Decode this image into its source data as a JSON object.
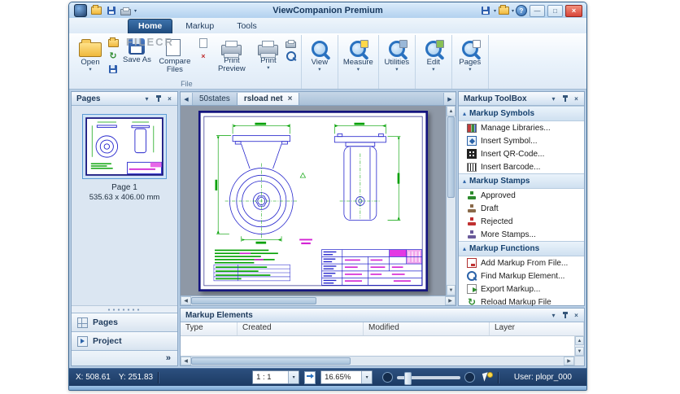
{
  "window": {
    "title": "ViewCompanion Premium"
  },
  "watermark": "FILECR",
  "ribbon_tabs": {
    "home": "Home",
    "markup": "Markup",
    "tools": "Tools"
  },
  "ribbon": {
    "open": "Open",
    "save_as": "Save As",
    "compare_files": "Compare Files",
    "print_preview": "Print Preview",
    "print": "Print",
    "file_group_label": "File",
    "view": "View",
    "measure": "Measure",
    "utilities": "Utilities",
    "edit": "Edit",
    "pages": "Pages"
  },
  "pages_panel": {
    "title": "Pages",
    "page_label": "Page 1",
    "page_size": "535.63 x 406.00 mm",
    "pages_button": "Pages",
    "project_button": "Project",
    "collapse_chevrons": "»"
  },
  "doc_tabs": {
    "tab_50states": "50states",
    "tab_rsload": "rsload net",
    "close_glyph": "×",
    "scroll_left": "◀",
    "scroll_right": "▶"
  },
  "toolbox": {
    "title": "Markup ToolBox",
    "sections": [
      {
        "title": "Markup Symbols",
        "items": [
          {
            "label": "Manage Libraries...",
            "icon": "library-books-icon"
          },
          {
            "label": "Insert Symbol...",
            "icon": "symbol-icon"
          },
          {
            "label": "Insert QR-Code...",
            "icon": "qr-code-icon"
          },
          {
            "label": "Insert Barcode...",
            "icon": "barcode-icon"
          }
        ]
      },
      {
        "title": "Markup Stamps",
        "items": [
          {
            "label": "Approved",
            "icon": "stamp-approved-icon"
          },
          {
            "label": "Draft",
            "icon": "stamp-draft-icon"
          },
          {
            "label": "Rejected",
            "icon": "stamp-rejected-icon"
          },
          {
            "label": "More Stamps...",
            "icon": "stamp-more-icon"
          }
        ]
      },
      {
        "title": "Markup Functions",
        "items": [
          {
            "label": "Add Markup From File...",
            "icon": "add-markup-file-icon"
          },
          {
            "label": "Find Markup Element...",
            "icon": "find-markup-icon"
          },
          {
            "label": "Export Markup...",
            "icon": "export-markup-icon"
          },
          {
            "label": "Reload Markup File",
            "icon": "reload-markup-icon"
          }
        ]
      }
    ]
  },
  "elements_panel": {
    "title": "Markup Elements",
    "columns": [
      "Type",
      "Created",
      "Modified",
      "Layer"
    ]
  },
  "statusbar": {
    "x": "X: 508.61",
    "y": "Y: 251.83",
    "ratio": "1 : 1",
    "zoom": "16.65%",
    "user": "User: plopr_000"
  },
  "colors": {
    "titlebar": "#b9d7f1",
    "accent": "#2a5a9a",
    "close_button": "#d8453a",
    "drawing_blue": "#2323cc",
    "dimension_green": "#00a000",
    "markup_magenta": "#d424d4",
    "status_navy": "#1c3a63"
  }
}
